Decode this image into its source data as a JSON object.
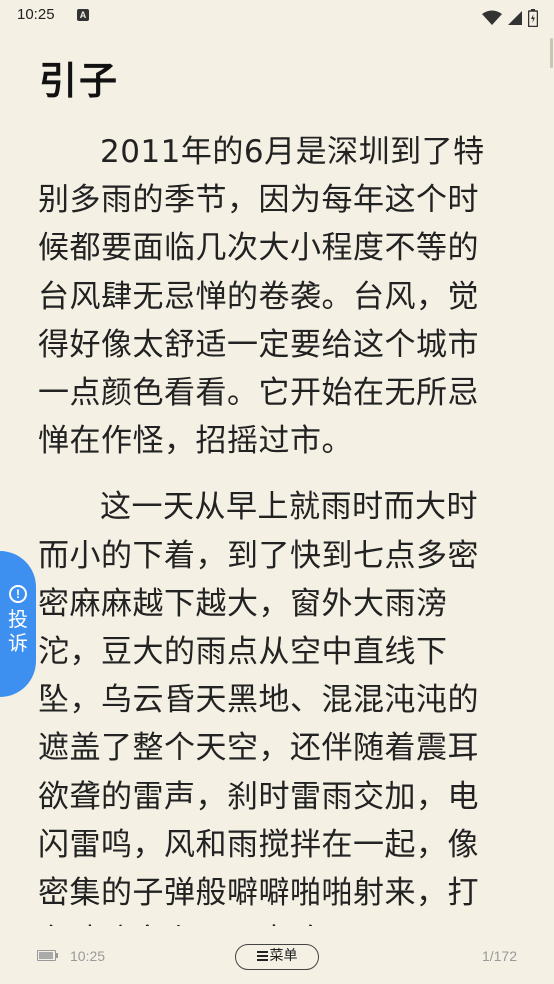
{
  "status_bar": {
    "time": "10:25",
    "notification_icon": "A",
    "icons": [
      "wifi-icon",
      "signal-icon",
      "battery-icon"
    ]
  },
  "chapter": {
    "title": "引子",
    "paragraphs": [
      "2011年的6月是深圳到了特别多雨的季节，因为每年这个时候都要面临几次大小程度不等的台风肆无忌惮的卷袭。台风，觉得好像太舒适一定要给这个城市一点颜色看看。它开始在无所忌惮在作怪，招摇过市。",
      "这一天从早上就雨时而大时而小的下着，到了快到七点多密密麻麻越下越大，窗外大雨滂沱，豆大的雨点从空中直线下坠，乌云昏天黑地、混混沌沌的遮盖了整个天空，还伴随着震耳欲聋的雷声，刹时雷雨交加，电闪雷鸣，风和雨搅拌在一起，像密集的子弹般噼噼啪啪射来，打在玻璃窗上叭叭声响。"
    ]
  },
  "report_tab": {
    "icon": "!",
    "label": "投诉"
  },
  "bottom_bar": {
    "time": "10:25",
    "menu_label": "菜单",
    "page_indicator": "1/172"
  },
  "colors": {
    "background": "#f4f0e4",
    "report_tab": "#3d8ff0",
    "text": "#222222"
  }
}
